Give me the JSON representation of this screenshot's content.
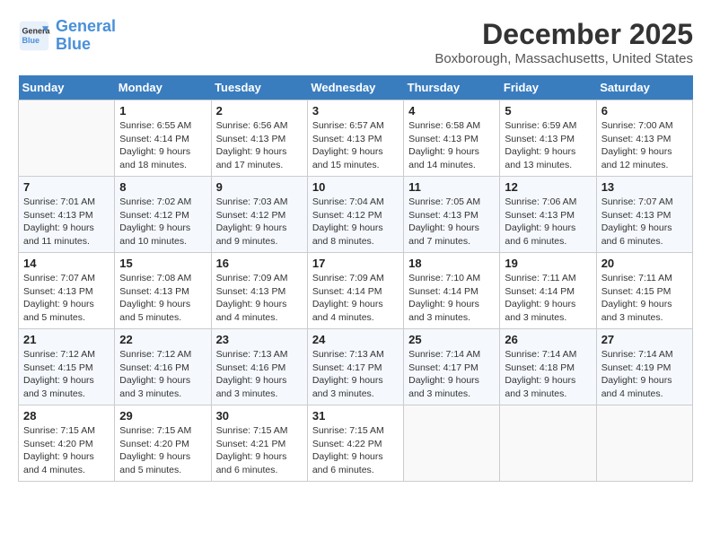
{
  "logo": {
    "line1": "General",
    "line2": "Blue"
  },
  "title": "December 2025",
  "location": "Boxborough, Massachusetts, United States",
  "weekdays": [
    "Sunday",
    "Monday",
    "Tuesday",
    "Wednesday",
    "Thursday",
    "Friday",
    "Saturday"
  ],
  "weeks": [
    [
      {
        "day": "",
        "sunrise": "",
        "sunset": "",
        "daylight": ""
      },
      {
        "day": "1",
        "sunrise": "Sunrise: 6:55 AM",
        "sunset": "Sunset: 4:14 PM",
        "daylight": "Daylight: 9 hours and 18 minutes."
      },
      {
        "day": "2",
        "sunrise": "Sunrise: 6:56 AM",
        "sunset": "Sunset: 4:13 PM",
        "daylight": "Daylight: 9 hours and 17 minutes."
      },
      {
        "day": "3",
        "sunrise": "Sunrise: 6:57 AM",
        "sunset": "Sunset: 4:13 PM",
        "daylight": "Daylight: 9 hours and 15 minutes."
      },
      {
        "day": "4",
        "sunrise": "Sunrise: 6:58 AM",
        "sunset": "Sunset: 4:13 PM",
        "daylight": "Daylight: 9 hours and 14 minutes."
      },
      {
        "day": "5",
        "sunrise": "Sunrise: 6:59 AM",
        "sunset": "Sunset: 4:13 PM",
        "daylight": "Daylight: 9 hours and 13 minutes."
      },
      {
        "day": "6",
        "sunrise": "Sunrise: 7:00 AM",
        "sunset": "Sunset: 4:13 PM",
        "daylight": "Daylight: 9 hours and 12 minutes."
      }
    ],
    [
      {
        "day": "7",
        "sunrise": "Sunrise: 7:01 AM",
        "sunset": "Sunset: 4:13 PM",
        "daylight": "Daylight: 9 hours and 11 minutes."
      },
      {
        "day": "8",
        "sunrise": "Sunrise: 7:02 AM",
        "sunset": "Sunset: 4:12 PM",
        "daylight": "Daylight: 9 hours and 10 minutes."
      },
      {
        "day": "9",
        "sunrise": "Sunrise: 7:03 AM",
        "sunset": "Sunset: 4:12 PM",
        "daylight": "Daylight: 9 hours and 9 minutes."
      },
      {
        "day": "10",
        "sunrise": "Sunrise: 7:04 AM",
        "sunset": "Sunset: 4:12 PM",
        "daylight": "Daylight: 9 hours and 8 minutes."
      },
      {
        "day": "11",
        "sunrise": "Sunrise: 7:05 AM",
        "sunset": "Sunset: 4:13 PM",
        "daylight": "Daylight: 9 hours and 7 minutes."
      },
      {
        "day": "12",
        "sunrise": "Sunrise: 7:06 AM",
        "sunset": "Sunset: 4:13 PM",
        "daylight": "Daylight: 9 hours and 6 minutes."
      },
      {
        "day": "13",
        "sunrise": "Sunrise: 7:07 AM",
        "sunset": "Sunset: 4:13 PM",
        "daylight": "Daylight: 9 hours and 6 minutes."
      }
    ],
    [
      {
        "day": "14",
        "sunrise": "Sunrise: 7:07 AM",
        "sunset": "Sunset: 4:13 PM",
        "daylight": "Daylight: 9 hours and 5 minutes."
      },
      {
        "day": "15",
        "sunrise": "Sunrise: 7:08 AM",
        "sunset": "Sunset: 4:13 PM",
        "daylight": "Daylight: 9 hours and 5 minutes."
      },
      {
        "day": "16",
        "sunrise": "Sunrise: 7:09 AM",
        "sunset": "Sunset: 4:13 PM",
        "daylight": "Daylight: 9 hours and 4 minutes."
      },
      {
        "day": "17",
        "sunrise": "Sunrise: 7:09 AM",
        "sunset": "Sunset: 4:14 PM",
        "daylight": "Daylight: 9 hours and 4 minutes."
      },
      {
        "day": "18",
        "sunrise": "Sunrise: 7:10 AM",
        "sunset": "Sunset: 4:14 PM",
        "daylight": "Daylight: 9 hours and 3 minutes."
      },
      {
        "day": "19",
        "sunrise": "Sunrise: 7:11 AM",
        "sunset": "Sunset: 4:14 PM",
        "daylight": "Daylight: 9 hours and 3 minutes."
      },
      {
        "day": "20",
        "sunrise": "Sunrise: 7:11 AM",
        "sunset": "Sunset: 4:15 PM",
        "daylight": "Daylight: 9 hours and 3 minutes."
      }
    ],
    [
      {
        "day": "21",
        "sunrise": "Sunrise: 7:12 AM",
        "sunset": "Sunset: 4:15 PM",
        "daylight": "Daylight: 9 hours and 3 minutes."
      },
      {
        "day": "22",
        "sunrise": "Sunrise: 7:12 AM",
        "sunset": "Sunset: 4:16 PM",
        "daylight": "Daylight: 9 hours and 3 minutes."
      },
      {
        "day": "23",
        "sunrise": "Sunrise: 7:13 AM",
        "sunset": "Sunset: 4:16 PM",
        "daylight": "Daylight: 9 hours and 3 minutes."
      },
      {
        "day": "24",
        "sunrise": "Sunrise: 7:13 AM",
        "sunset": "Sunset: 4:17 PM",
        "daylight": "Daylight: 9 hours and 3 minutes."
      },
      {
        "day": "25",
        "sunrise": "Sunrise: 7:14 AM",
        "sunset": "Sunset: 4:17 PM",
        "daylight": "Daylight: 9 hours and 3 minutes."
      },
      {
        "day": "26",
        "sunrise": "Sunrise: 7:14 AM",
        "sunset": "Sunset: 4:18 PM",
        "daylight": "Daylight: 9 hours and 3 minutes."
      },
      {
        "day": "27",
        "sunrise": "Sunrise: 7:14 AM",
        "sunset": "Sunset: 4:19 PM",
        "daylight": "Daylight: 9 hours and 4 minutes."
      }
    ],
    [
      {
        "day": "28",
        "sunrise": "Sunrise: 7:15 AM",
        "sunset": "Sunset: 4:20 PM",
        "daylight": "Daylight: 9 hours and 4 minutes."
      },
      {
        "day": "29",
        "sunrise": "Sunrise: 7:15 AM",
        "sunset": "Sunset: 4:20 PM",
        "daylight": "Daylight: 9 hours and 5 minutes."
      },
      {
        "day": "30",
        "sunrise": "Sunrise: 7:15 AM",
        "sunset": "Sunset: 4:21 PM",
        "daylight": "Daylight: 9 hours and 6 minutes."
      },
      {
        "day": "31",
        "sunrise": "Sunrise: 7:15 AM",
        "sunset": "Sunset: 4:22 PM",
        "daylight": "Daylight: 9 hours and 6 minutes."
      },
      {
        "day": "",
        "sunrise": "",
        "sunset": "",
        "daylight": ""
      },
      {
        "day": "",
        "sunrise": "",
        "sunset": "",
        "daylight": ""
      },
      {
        "day": "",
        "sunrise": "",
        "sunset": "",
        "daylight": ""
      }
    ]
  ]
}
